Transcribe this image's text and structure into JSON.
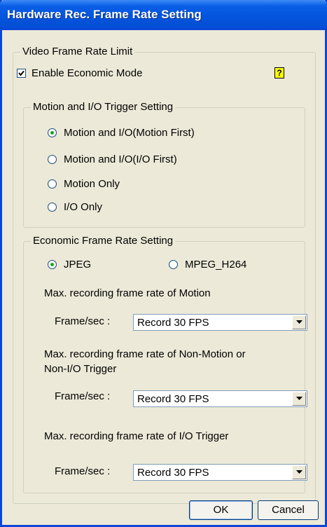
{
  "window": {
    "title": "Hardware Rec. Frame Rate Setting"
  },
  "video_group": {
    "legend": "Video Frame Rate Limit",
    "economic_checkbox": {
      "label": "Enable Economic Mode",
      "checked": true
    },
    "help_icon": "question-icon"
  },
  "trigger_group": {
    "legend": "Motion and I/O Trigger Setting",
    "options": [
      {
        "label": "Motion and I/O(Motion First)",
        "checked": true
      },
      {
        "label": "Motion and I/O(I/O First)",
        "checked": false
      },
      {
        "label": "Motion Only",
        "checked": false
      },
      {
        "label": "I/O Only",
        "checked": false
      }
    ]
  },
  "economic_group": {
    "legend": "Economic Frame Rate Setting",
    "codec": [
      {
        "label": "JPEG",
        "checked": true
      },
      {
        "label": "MPEG_H264",
        "checked": false
      }
    ],
    "motion": {
      "heading": "Max. recording frame rate of Motion",
      "field_label": "Frame/sec :",
      "value": "Record 30 FPS"
    },
    "non_motion": {
      "heading_line1": "Max. recording frame rate of Non-Motion or",
      "heading_line2": "Non-I/O Trigger",
      "field_label": "Frame/sec :",
      "value": "Record 30 FPS"
    },
    "io_trigger": {
      "heading": "Max. recording frame rate of I/O Trigger",
      "field_label": "Frame/sec :",
      "value": "Record 30 FPS"
    }
  },
  "buttons": {
    "ok": "OK",
    "cancel": "Cancel"
  }
}
